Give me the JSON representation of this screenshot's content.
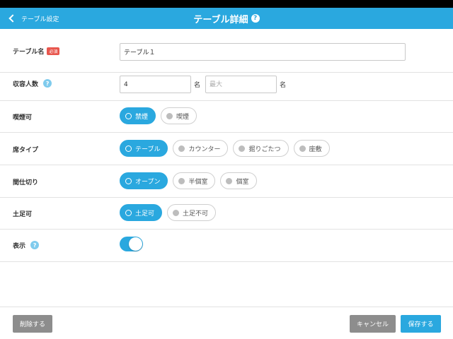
{
  "nav": {
    "back_label": "テーブル設定",
    "title": "テーブル詳細",
    "help": "?"
  },
  "form": {
    "table_name": {
      "label": "テーブル名",
      "badge": "必須",
      "value": "テーブル１"
    },
    "capacity": {
      "label": "収容人数",
      "help": "?",
      "min_value": "4",
      "max_placeholder": "最大",
      "unit": "名"
    },
    "smoking": {
      "label": "喫煙可",
      "options": [
        "禁煙",
        "喫煙"
      ],
      "selected": 0
    },
    "seat_type": {
      "label": "席タイプ",
      "options": [
        "テーブル",
        "カウンター",
        "掘りごたつ",
        "座敷"
      ],
      "selected": 0
    },
    "partition": {
      "label": "間仕切り",
      "options": [
        "オープン",
        "半個室",
        "個室"
      ],
      "selected": 0
    },
    "shoes": {
      "label": "土足可",
      "options": [
        "土足可",
        "土足不可"
      ],
      "selected": 0
    },
    "display": {
      "label": "表示",
      "help": "?",
      "enabled": true
    }
  },
  "footer": {
    "delete_label": "削除する",
    "cancel_label": "キャンセル",
    "save_label": "保存する"
  },
  "colors": {
    "accent": "#2aa8df",
    "required_badge": "#e8564d",
    "gray_button": "#8d8d8d"
  }
}
